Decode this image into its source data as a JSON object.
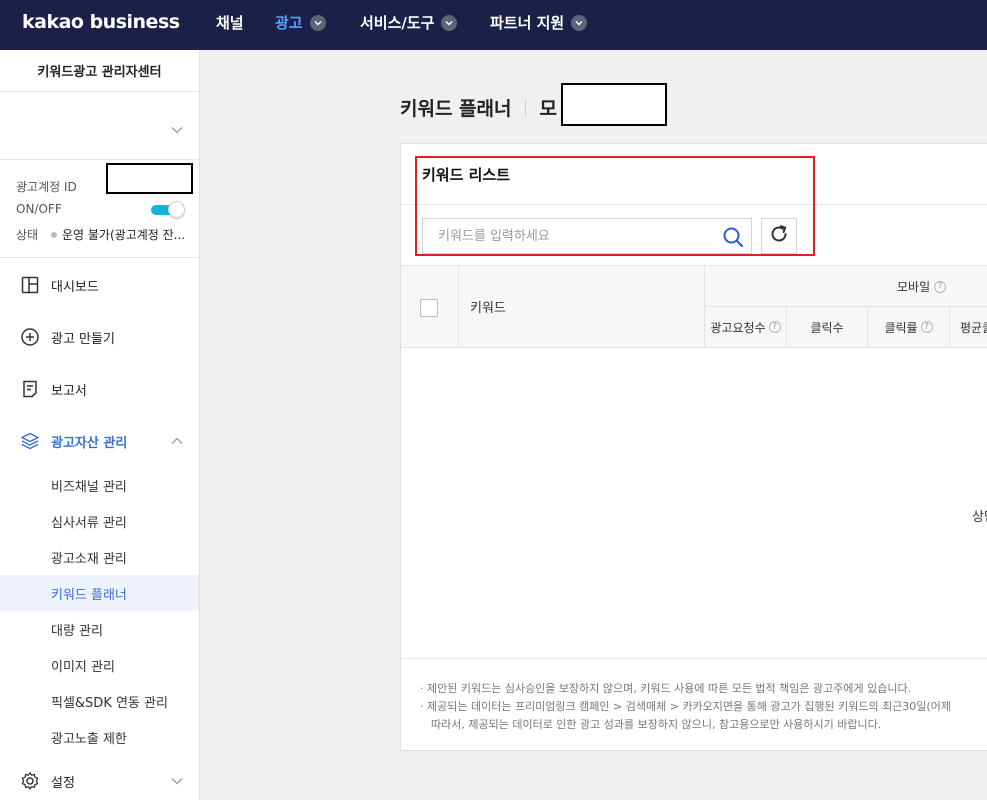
{
  "topnav": {
    "logo": "kakao business",
    "items": [
      {
        "label": "채널"
      },
      {
        "label": "광고"
      },
      {
        "label": "서비스/도구"
      },
      {
        "label": "파트너 지원"
      }
    ]
  },
  "sidebar": {
    "title": "키워드광고 관리자센터",
    "account": {
      "id_label": "광고계정 ID",
      "onoff_label": "ON/OFF",
      "status_label": "상태",
      "status_value": "운영 불가(광고계정 잔..."
    },
    "menu": [
      {
        "label": "대시보드",
        "icon": "dashboard-icon"
      },
      {
        "label": "광고 만들기",
        "icon": "plus-circle-icon"
      },
      {
        "label": "보고서",
        "icon": "report-icon"
      },
      {
        "label": "광고자산 관리",
        "icon": "layers-icon"
      },
      {
        "label": "설정",
        "icon": "gear-icon"
      }
    ],
    "submenu": [
      {
        "label": "비즈채널 관리"
      },
      {
        "label": "심사서류 관리"
      },
      {
        "label": "광고소재 관리"
      },
      {
        "label": "키워드 플래너"
      },
      {
        "label": "대량 관리"
      },
      {
        "label": "이미지 관리"
      },
      {
        "label": "픽셀&SDK 연동 관리"
      },
      {
        "label": "광고노출 제한"
      }
    ],
    "accent_color": "#3a6fd8",
    "toggle_color": "#13b5d6"
  },
  "main": {
    "title": "키워드 플래너",
    "title_suffix": "모",
    "card": {
      "title": "키워드 리스트",
      "search_placeholder": "키워드를 입력하세요",
      "table": {
        "keyword_header": "키워드",
        "group_header": "모바일",
        "columns": [
          "광고요청수",
          "클릭수",
          "클릭률",
          "평균클"
        ]
      },
      "empty_text": "상단",
      "notes": [
        "· 제안된 키워드는 심사승인을 보장하지 않으며, 키워드 사용에 따른 모든 법적 책임은 광고주에게 있습니다.",
        "· 제공되는 데이터는 프리미엄링크 캠페인 > 검색매체 > 카카오지면을 통해 광고가 집행된 키워드의 최근30일(어제",
        "  따라서, 제공되는 데이터로 인한 광고 성과를 보장하지 않으니, 참고용으로만 사용하시기 바랍니다."
      ]
    },
    "highlight_color": "#e02020"
  }
}
